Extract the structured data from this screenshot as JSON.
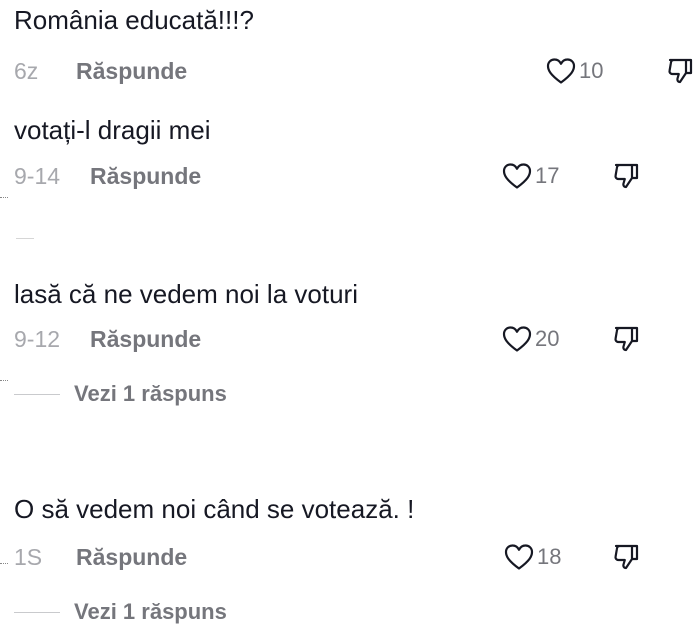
{
  "comments": [
    {
      "text": "România educată!!!?",
      "date": "6z",
      "reply_label": "Răspunde",
      "likes": "10"
    },
    {
      "text": "votați-l dragii mei",
      "date": "9-14",
      "reply_label": "Răspunde",
      "likes": "17"
    },
    {
      "text": "lasă că ne vedem noi la voturi",
      "date": "9-12",
      "reply_label": "Răspunde",
      "likes": "20",
      "view_replies": "Vezi 1 răspuns"
    },
    {
      "text": "O să vedem noi când se votează. !",
      "date": "1S",
      "reply_label": "Răspunde",
      "likes": "18",
      "view_replies": "Vezi 1 răspuns"
    }
  ],
  "colors": {
    "text": "#161823",
    "secondary": "#75767c",
    "date": "#a7a8ad",
    "icon": "#161823"
  },
  "icons": {
    "like": "heart-outline-icon",
    "dislike": "thumbs-down-icon"
  }
}
